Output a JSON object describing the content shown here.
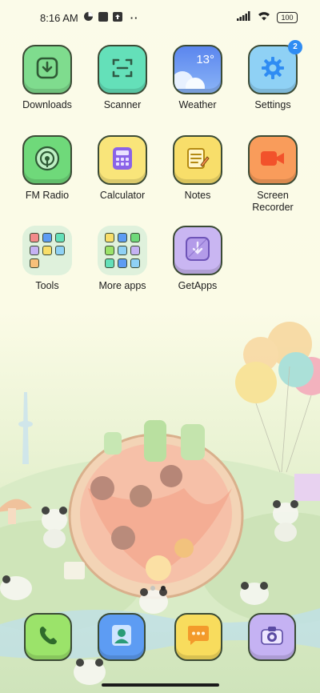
{
  "status": {
    "time": "8:16 AM",
    "battery": "100"
  },
  "apps": [
    {
      "label": "Downloads",
      "icon": "download-icon"
    },
    {
      "label": "Scanner",
      "icon": "scanner-icon"
    },
    {
      "label": "Weather",
      "icon": "weather-icon",
      "temperature": "13°"
    },
    {
      "label": "Settings",
      "icon": "gear-icon",
      "badge": "2"
    },
    {
      "label": "FM Radio",
      "icon": "radio-icon"
    },
    {
      "label": "Calculator",
      "icon": "calculator-icon"
    },
    {
      "label": "Notes",
      "icon": "notes-icon"
    },
    {
      "label": "Screen\nRecorder",
      "icon": "video-camera-icon"
    },
    {
      "label": "Tools",
      "icon": "folder-icon"
    },
    {
      "label": "More apps",
      "icon": "folder-icon"
    },
    {
      "label": "GetApps",
      "icon": "getapps-icon"
    }
  ],
  "dock": [
    {
      "icon": "phone-icon"
    },
    {
      "icon": "contacts-icon"
    },
    {
      "icon": "messages-icon"
    },
    {
      "icon": "camera-icon"
    }
  ],
  "colors": {
    "downloads": "#7fdc8e",
    "scanner": "#64e0b9",
    "weather": "#6f9cf3",
    "settings": "#8fd1f5",
    "radio": "#6fd97a",
    "calculator": "#f9e57a",
    "notes": "#f8de6a",
    "recorder": "#f99c5b",
    "getapps": "#c9b6f2",
    "phone": "#9be36a",
    "contacts": "#5d9cf3",
    "messages": "#f8dc5d",
    "camera": "#c5b2f3"
  },
  "pages": {
    "count": 2,
    "active": 2
  }
}
